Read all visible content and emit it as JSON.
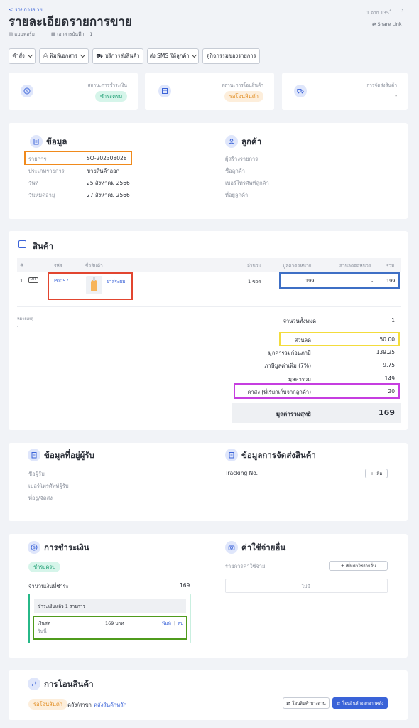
{
  "header": {
    "breadcrumb": "< รายการขาย",
    "title": "รายละเอียดรายการขาย",
    "template_label": "แบบฟอร์ม",
    "doc_ref_label": "เอกสารบันทึก",
    "doc_ref_value": "1",
    "pagination": "1 จาก 135",
    "share_link": "Share Link"
  },
  "toolbar": {
    "command": "คำสั่ง",
    "print": "พิมพ์เอกสาร",
    "shipping_service": "บริการส่งสินค้า",
    "send_sms": "ส่ง SMS ให้ลูกค้า",
    "view_activity": "ดูกิจกรรมของรายการ"
  },
  "status": {
    "payment_label": "สถานะการชำระเงิน",
    "payment_value": "ชำระครบ",
    "transfer_label": "สถานะการโอนสินค้า",
    "transfer_value": "รอโอนสินค้า",
    "shipping_label": "การจัดส่งสินค้า",
    "shipping_value": "-"
  },
  "info": {
    "title": "ข้อมูล",
    "rows": [
      {
        "label": "รายการ",
        "value": "SO-202308028"
      },
      {
        "label": "ประเภทรายการ",
        "value": "ขายสินค้าออก"
      },
      {
        "label": "วันที่",
        "value": "25 สิงหาคม 2566"
      },
      {
        "label": "วันหมดอายุ",
        "value": "27 สิงหาคม 2566"
      }
    ]
  },
  "customer": {
    "title": "ลูกค้า",
    "rows": [
      "ผู้สร้างรายการ",
      "ชื่อลูกค้า",
      "เบอร์โทรศัพท์ลูกค้า",
      "ที่อยู่ลูกค้า"
    ]
  },
  "products": {
    "title": "สินค้า",
    "headers": {
      "no": "#",
      "code": "รหัส",
      "name": "ชื่อสินค้า",
      "qty": "จำนวน",
      "unit_price": "มูลค่าต่อหน่วย",
      "discount": "ส่วนลดต่อหน่วย",
      "total": "รวม"
    },
    "items": [
      {
        "no": "1",
        "tag": "LOT",
        "code": "P0057",
        "name": "ยาสระผม",
        "qty": "1 ขวด",
        "unit_price": "199",
        "discount": "-",
        "total": "199"
      }
    ],
    "note_label": "หมายเหตุ",
    "note_value": "-"
  },
  "summary": {
    "total_qty_label": "จำนวนทั้งหมด",
    "total_qty": "1",
    "discount_label": "ส่วนลด",
    "discount": "50.00",
    "pre_vat_label": "มูลค่ารวมก่อนภาษี",
    "pre_vat": "139.25",
    "vat_label": "ภาษีมูลค่าเพิ่ม (7%)",
    "vat": "9.75",
    "subtotal_label": "มูลค่ารวม",
    "subtotal": "149",
    "shipping_label": "ค่าส่ง (ที่เรียกเก็บจากลูกค้า)",
    "shipping": "20",
    "net_label": "มูลค่ารวมสุทธิ",
    "net": "169"
  },
  "recipient": {
    "title": "ข้อมูลที่อยู่ผู้รับ",
    "rows": [
      "ชื่อผู้รับ",
      "เบอร์โทรศัพท์ผู้รับ",
      "ที่อยู่/จัดส่ง"
    ]
  },
  "delivery": {
    "title": "ข้อมูลการจัดส่งสินค้า",
    "tracking_label": "Tracking No.",
    "add_button": "+ เพิ่ม"
  },
  "payment": {
    "title": "การชำระเงิน",
    "status": "ชำระครบ",
    "amount_label": "จำนวนเงินที่ชำระ",
    "amount": "169",
    "paid_header": "ชำระเงินแล้ว 1 รายการ",
    "method": "เงินสด",
    "paid_amount": "169 บาท",
    "print_link": "พิมพ์",
    "delete_link": "ลบ",
    "date_label": "วันนี้"
  },
  "expenses": {
    "title": "ค่าใช้จ่ายอื่น",
    "label": "รายการค่าใช้จ่าย",
    "add_button": "+ เพิ่มค่าใช้จ่ายอื่น",
    "empty": "ไม่มี"
  },
  "transfer": {
    "title": "การโอนสินค้า",
    "status": "รอโอนสินค้า",
    "warehouse_label": "คลัง/สาขา",
    "warehouse_value": "คลังสินค้าหลัก",
    "partial_button": "โอนสินค้าบางส่วน",
    "transfer_button": "โอนสินค้าออกจากคลัง"
  },
  "colors": {
    "primary": "#3a63d8",
    "highlight_orange": "#f08a1c",
    "highlight_red": "#e2452f",
    "highlight_blue": "#3e6fc5",
    "highlight_yellow": "#f3dc3c",
    "highlight_purple": "#c63ee0",
    "highlight_green": "#4f9b1c"
  }
}
